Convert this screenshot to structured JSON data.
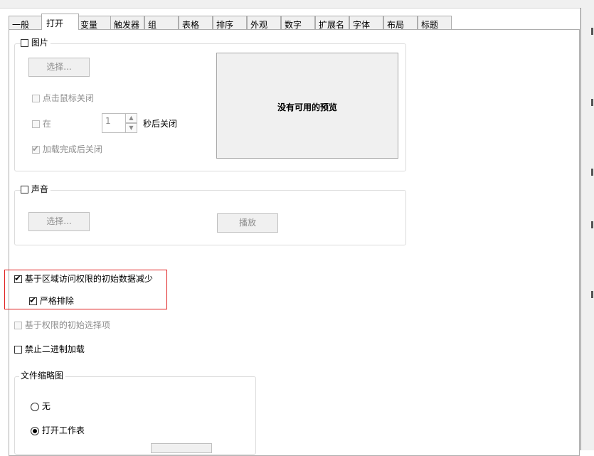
{
  "tabs": [
    {
      "label": "一般",
      "active": false
    },
    {
      "label": "打开",
      "active": true
    },
    {
      "label": "变量",
      "active": false
    },
    {
      "label": "触发器",
      "active": false
    },
    {
      "label": "组",
      "active": false
    },
    {
      "label": "表格",
      "active": false
    },
    {
      "label": "排序",
      "active": false
    },
    {
      "label": "外观",
      "active": false
    },
    {
      "label": "数字",
      "active": false
    },
    {
      "label": "扩展名",
      "active": false
    },
    {
      "label": "字体",
      "active": false
    },
    {
      "label": "布局",
      "active": false
    },
    {
      "label": "标题",
      "active": false
    }
  ],
  "picture_group": {
    "label": "图片",
    "checked": false,
    "select_button": "选择...",
    "close_on_click": "点击鼠标关闭",
    "close_after_prefix": "在",
    "seconds_value": "1",
    "close_after_suffix": "秒后关闭",
    "close_after_load": "加载完成后关闭",
    "preview_text": "没有可用的预览"
  },
  "sound_group": {
    "label": "声音",
    "checked": false,
    "select_button": "选择...",
    "play_button": "播放"
  },
  "options": {
    "reduce_initial_data": "基于区域访问权限的初始数据减少",
    "strict_exclusion": "严格排除",
    "initial_selection": "基于权限的初始选择项",
    "disable_binary_load": "禁止二进制加载"
  },
  "thumbnail_group": {
    "label": "文件缩略图",
    "none": "无",
    "open_sheet": "打开工作表"
  },
  "colors": {
    "highlight_border": "#e02020"
  }
}
